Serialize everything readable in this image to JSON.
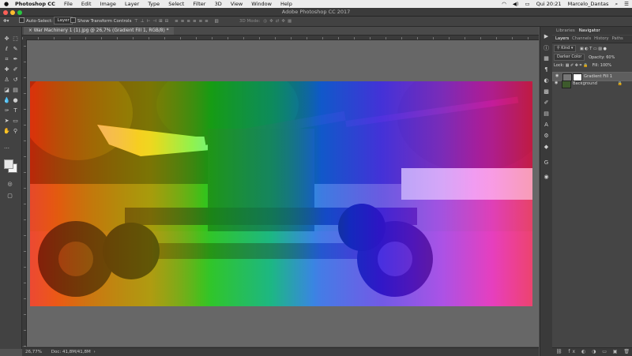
{
  "menubar": {
    "apple": "",
    "app_name": "Photoshop CC",
    "menus": [
      "File",
      "Edit",
      "Image",
      "Layer",
      "Type",
      "Select",
      "Filter",
      "3D",
      "View",
      "Window",
      "Help"
    ],
    "clock": "Qui 20:21",
    "user": "Marcelo_Dantas"
  },
  "window": {
    "title": "Adobe Photoshop CC 2017"
  },
  "options_bar": {
    "auto_select_label": "Auto-Select:",
    "auto_select_value": "Layer",
    "transform_label": "Show Transform Controls",
    "mode3d_label": "3D Mode:"
  },
  "document": {
    "tab_title": "War Machinery 1 (1).jpg @ 26,7% (Gradient Fill 1, RGB/8) *",
    "zoom": "26,77%",
    "doc_info": "Doc: 41,8M/41,8M"
  },
  "panels": {
    "top_tabs": [
      "Libraries",
      "Navigator"
    ],
    "tabs": [
      "Layers",
      "Channels",
      "History",
      "Paths"
    ],
    "filter_kind": "Kind",
    "blend_mode": "Darker Color",
    "opacity_label": "Opacity:",
    "opacity_value": "60%",
    "lock_label": "Lock:",
    "fill_label": "Fill:",
    "fill_value": "100%",
    "layers": [
      {
        "name": "Gradient Fill 1"
      },
      {
        "name": "Background"
      }
    ]
  },
  "colors": {
    "accent": "#2d7be0",
    "close": "#fc5f57",
    "minimize": "#fdbc2e",
    "zoom": "#28c840"
  }
}
